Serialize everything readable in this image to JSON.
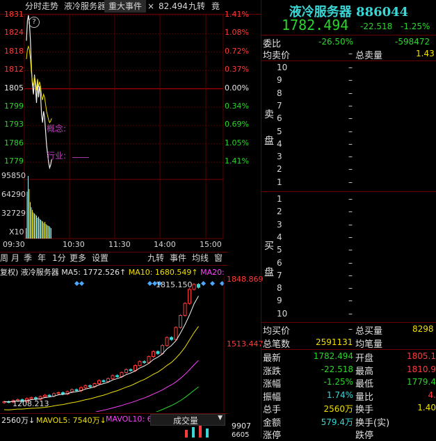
{
  "left_tabs": {
    "intraday": "分时走势",
    "stock_name_tab": "液冷服务器",
    "major_events": "重大事件",
    "close_x": "×",
    "price_value": "82.494",
    "nine_turn": "九转",
    "bid_tab": "竟"
  },
  "intraday": {
    "price_ticks": [
      "1831",
      "1824",
      "1818",
      "1812",
      "1805",
      "1799",
      "1793",
      "1786",
      "1779"
    ],
    "pct_ticks": [
      "1.41%",
      "1.08%",
      "0.72%",
      "0.37%",
      "0.00%",
      "0.34%",
      "0.69%",
      "1.05%",
      "1.41%"
    ],
    "vol_ticks": [
      "95850",
      "64290",
      "32729",
      "X10"
    ],
    "time_ticks": [
      "09:30",
      "10:30",
      "11:30",
      "14:00",
      "15:00"
    ],
    "concept_label": "概念:",
    "industry_label": "行业:",
    "industry_value": "____",
    "help_icon_glyph": "?",
    "price_series": [
      1822,
      1829,
      1831,
      1828,
      1822,
      1812,
      1806,
      1803,
      1810,
      1806,
      1800,
      1808,
      1802,
      1806,
      1803,
      1796,
      1793,
      1797,
      1795,
      1790,
      1785,
      1782,
      1779,
      1777,
      1778,
      1780
    ],
    "volume_series": [
      20,
      90,
      120,
      95,
      70,
      60,
      55,
      50,
      48,
      46,
      44,
      40,
      42,
      38,
      36,
      34,
      33,
      30,
      32,
      28,
      26,
      25,
      24,
      22,
      20
    ]
  },
  "period_tabs": [
    "周",
    "月",
    "季",
    "年",
    "1分",
    "更多",
    "设置"
  ],
  "mid_tabs": {
    "nine_turn": "九转",
    "events": "事件",
    "ma_line": "均线",
    "window": "窗"
  },
  "kline": {
    "legend_prefix": "复权)",
    "legend_name": "液冷服务器",
    "ma5": "MA5: 1772.526↑",
    "ma10": "MA10: 1680.549↑",
    "ma20": "MA20:",
    "high_label": "1815.150",
    "low_label": "1208.213",
    "axis_top": "1848.869",
    "axis_mid": "1513.447",
    "closes": [
      1230,
      1228,
      1235,
      1240,
      1232,
      1245,
      1250,
      1242,
      1255,
      1262,
      1258,
      1270,
      1275,
      1268,
      1280,
      1290,
      1285,
      1300,
      1310,
      1305,
      1320,
      1335,
      1330,
      1345,
      1360,
      1355,
      1375,
      1390,
      1385,
      1410,
      1430,
      1425,
      1455,
      1480,
      1470,
      1510,
      1550,
      1540,
      1600,
      1660,
      1720,
      1790,
      1815,
      1800
    ]
  },
  "vol_bar": {
    "vol": "2560万↓",
    "mavol5": "MAVOL5: 7540万↓",
    "mavol10": "MAVOL10: 6",
    "selector": "成交量",
    "axis": "9907",
    "axis2": "6605"
  },
  "quote": {
    "title": "液冷服务器 886044",
    "price": "1782.494",
    "change": "-22.518",
    "change_pct": "-1.25%",
    "weibi_label": "委比",
    "weibi_pct": "-26.50%",
    "weibi_val": "-598472",
    "avg_sell_label": "均卖价",
    "total_sell_label": "总卖量",
    "total_sell_val": "1.43",
    "sell_side_label_1": "卖",
    "sell_side_label_2": "盘",
    "buy_side_label_1": "买",
    "buy_side_label_2": "盘",
    "sell_levels": [
      "10",
      "9",
      "8",
      "7",
      "6",
      "5",
      "4",
      "3",
      "2",
      "1"
    ],
    "buy_levels": [
      "1",
      "2",
      "3",
      "4",
      "5",
      "6",
      "7",
      "8",
      "9",
      "10"
    ],
    "dash": "–",
    "avg_buy_label": "均买价",
    "total_buy_label": "总买量",
    "total_buy_val": "8298",
    "total_trades_label": "总笔数",
    "total_trades_val": "2591131",
    "avg_trade_label": "均笔量",
    "stats": [
      {
        "l1": "最新",
        "v1": "1782.494",
        "c1": "green",
        "l2": "开盘",
        "v2": "1805.1",
        "c2": "red"
      },
      {
        "l1": "涨跌",
        "v1": "-22.518",
        "c1": "green",
        "l2": "最高",
        "v2": "1810.9",
        "c2": "red"
      },
      {
        "l1": "涨幅",
        "v1": "-1.25%",
        "c1": "green",
        "l2": "最低",
        "v2": "1779.4",
        "c2": "green"
      },
      {
        "l1": "振幅",
        "v1": "1.74%",
        "c1": "cyan",
        "l2": "量比",
        "v2": "4.",
        "c2": "red"
      },
      {
        "l1": "总手",
        "v1": "2560万",
        "c1": "yellow",
        "l2": "换手",
        "v2": "1.40",
        "c2": "yellow"
      },
      {
        "l1": "金额",
        "v1": "579.4万",
        "c1": "cyan",
        "l2": "换手(实)",
        "v2": "",
        "c2": "yellow"
      },
      {
        "l1": "涨停",
        "v1": "",
        "c1": "red",
        "l2": "跌停",
        "v2": "",
        "c2": "green"
      }
    ]
  }
}
